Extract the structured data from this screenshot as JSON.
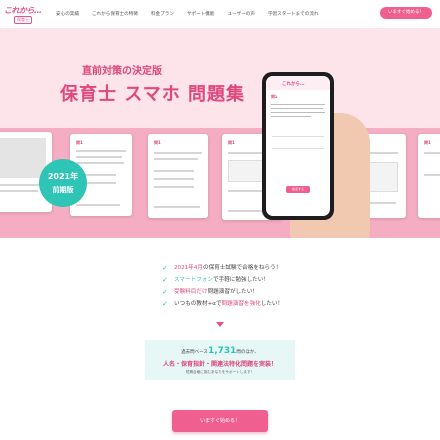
{
  "header": {
    "logo_text": "これから…",
    "logo_sub": "保育士",
    "nav": [
      "安心の実績",
      "これから保育士の特徴",
      "料金プラン",
      "サポート機能",
      "ユーザーの声",
      "学習スタートまでの流れ"
    ],
    "cta": "いますぐ始める！"
  },
  "hero": {
    "subtitle": "直前対策の決定版",
    "title": "保育士 スマホ 問題集",
    "badge_year": "2021年",
    "badge_term": "前期版",
    "card_question": "問1",
    "phone": {
      "logo": "これから…",
      "question": "問1",
      "button": "採点する"
    }
  },
  "features": {
    "items": [
      {
        "pre": "",
        "hl": "2021年4月",
        "post": "の保育士試験で合格をねらう！",
        "hl_color": "pink"
      },
      {
        "pre": "",
        "hl": "スマートフォン",
        "post": "で手軽に勉強したい！",
        "hl_color": "teal"
      },
      {
        "pre": "",
        "hl": "受験料目だけ",
        "post": "問題演習がしたい！",
        "hl_color": "pink"
      },
      {
        "pre": "いつもの教材+αで",
        "hl": "問題演習を強化",
        "post": "したい！",
        "hl_color": "pink"
      }
    ]
  },
  "info": {
    "line1_pre": "過去問ベース",
    "line1_num": "1,731",
    "line1_post": "問のほか、",
    "line2": "人名・保育指針・関連法特化問題を実装！",
    "line3": "短期合格に挑むあなたをサポートします！"
  },
  "cta_main": "いますぐ始める！",
  "colors": {
    "accent": "#e0477c",
    "teal": "#2ec4b6",
    "hero_bg": "#fde3ea"
  }
}
